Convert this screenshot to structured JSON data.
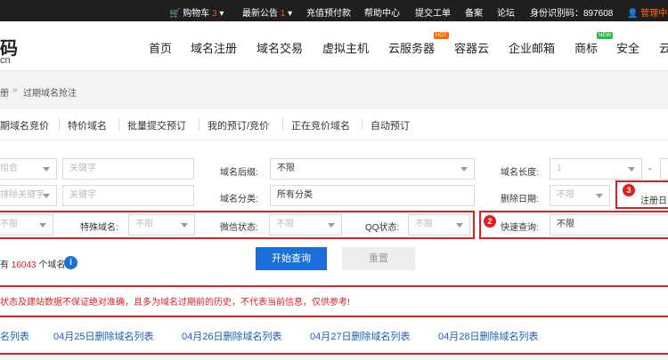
{
  "topbar": {
    "cart_label": "购物车",
    "cart_count": "3",
    "notice_label": "最新公告",
    "notice_count": "1",
    "recharge": "充值预付款",
    "help": "帮助中心",
    "ticket": "提交工单",
    "beian": "备案",
    "forum": "论坛",
    "id_code": "身份识别码：897608",
    "admin": "管理中"
  },
  "header": {
    "logo_main": "码",
    "logo_sub": "cn",
    "nav": [
      "首页",
      "域名注册",
      "域名交易",
      "虚拟主机",
      "云服务器",
      "容器云",
      "企业邮箱",
      "商标",
      "安全",
      "云"
    ],
    "hot_badge": "HOT",
    "new_badge": "NEW"
  },
  "breadcrumb": {
    "first": "册",
    "sep": "»",
    "current": "过期域名抢注"
  },
  "tabs": [
    "期域名竞价",
    "特价域名",
    "批量提交预订",
    "我的预订/竞价",
    "正在竞价域名",
    "自动预订"
  ],
  "filters": {
    "row1_select1": "组合",
    "row1_keyword": "关键字",
    "suffix_label": "域名后缀:",
    "suffix_value": "不限",
    "length_label": "域名长度:",
    "length_min": "1",
    "length_dash": "-",
    "row2_select1": "排除关键字",
    "row2_keyword": "关键字",
    "category_label": "域名分类:",
    "category_value": "所有分类",
    "delete_date_label": "删除日期:",
    "delete_date_value": "不限",
    "reg_date_label": "注册日",
    "row3_select1": "不限",
    "special_label": "特殊域名:",
    "special_value": "不限",
    "wechat_label": "微信状态:",
    "wechat_value": "不限",
    "qq_label": "QQ状态:",
    "qq_value": "不限",
    "quick_label": "快速查询:",
    "quick_value": "不限"
  },
  "markers": [
    "2",
    "3"
  ],
  "result": {
    "prefix": "有",
    "count": "16043",
    "suffix": "个域名",
    "info_icon": "i"
  },
  "buttons": {
    "search": "开始查询",
    "reset": "重置"
  },
  "notice": "状态及建站数据不保证绝对准确，且多为域名过期前的历史，不代表当前信息，仅供参考!",
  "date_lists": [
    "名列表",
    "04月25日删除域名列表",
    "04月26日删除域名列表",
    "04月27日删除域名列表",
    "04月28日删除域名列表"
  ],
  "colors": {
    "accent": "#1a6fd8",
    "highlight": "#e02020",
    "topbar": "#1f1f1f",
    "count": "#e02020"
  }
}
